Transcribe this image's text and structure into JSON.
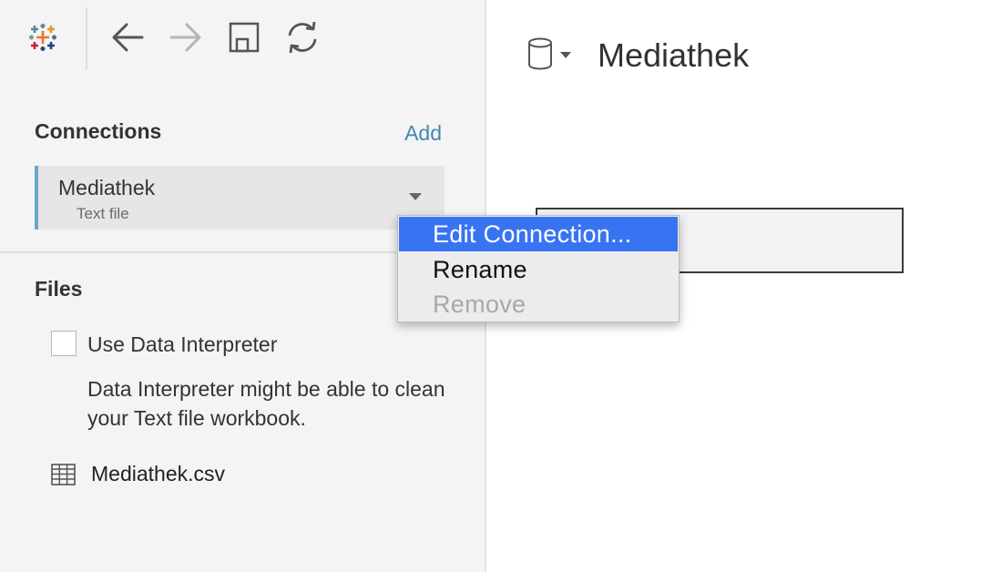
{
  "toolbar": {
    "icons": [
      "tableau-logo-icon",
      "back-arrow-icon",
      "forward-arrow-icon",
      "save-icon",
      "refresh-icon"
    ]
  },
  "connections": {
    "title": "Connections",
    "add_label": "Add",
    "items": [
      {
        "name": "Mediathek",
        "type": "Text file"
      }
    ]
  },
  "files": {
    "title": "Files",
    "use_interpreter_label": "Use Data Interpreter",
    "use_interpreter_checked": false,
    "interpreter_description": "Data Interpreter might be able to clean your Text file workbook.",
    "items": [
      {
        "name": "Mediathek.csv",
        "icon": "table-grid-icon"
      }
    ]
  },
  "canvas": {
    "title": "Mediathek",
    "name_field_value": ""
  },
  "context_menu": {
    "items": [
      {
        "label": "Edit Connection...",
        "state": "selected"
      },
      {
        "label": "Rename",
        "state": "normal"
      },
      {
        "label": "Remove",
        "state": "disabled"
      }
    ]
  },
  "colors": {
    "accent_link": "#3f8ab0",
    "selected_border": "#6aa6c6",
    "menu_highlight": "#3874f2",
    "sidebar_bg": "#f4f4f4"
  }
}
